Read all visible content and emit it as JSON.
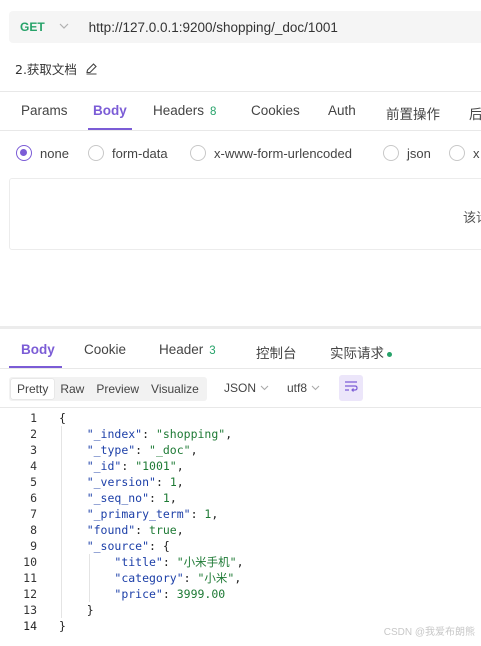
{
  "request": {
    "method": "GET",
    "url": "http://127.0.0.1:9200/shopping/_doc/1001",
    "name": "2.获取文档"
  },
  "request_tabs": [
    {
      "label": "Params"
    },
    {
      "label": "Body",
      "active": true
    },
    {
      "label": "Headers",
      "count": "8"
    },
    {
      "label": "Cookies"
    },
    {
      "label": "Auth"
    },
    {
      "label": "前置操作"
    },
    {
      "label": "后"
    }
  ],
  "body_types": [
    {
      "label": "none",
      "selected": true
    },
    {
      "label": "form-data"
    },
    {
      "label": "x-www-form-urlencoded"
    },
    {
      "label": "json"
    },
    {
      "label": "x"
    }
  ],
  "editor_hint": "该请",
  "response_tabs": [
    {
      "label": "Body",
      "active": true
    },
    {
      "label": "Cookie"
    },
    {
      "label": "Header",
      "count": "3"
    },
    {
      "label": "控制台"
    },
    {
      "label": "实际请求"
    }
  ],
  "format_buttons": [
    {
      "label": "Pretty",
      "active": true
    },
    {
      "label": "Raw"
    },
    {
      "label": "Preview"
    },
    {
      "label": "Visualize"
    }
  ],
  "selects": {
    "type": "JSON",
    "encoding": "utf8"
  },
  "code_lines": [
    "{",
    "    \"_index\": \"shopping\",",
    "    \"_type\": \"_doc\",",
    "    \"_id\": \"1001\",",
    "    \"_version\": 1,",
    "    \"_seq_no\": 1,",
    "    \"_primary_term\": 1,",
    "    \"found\": true,",
    "    \"_source\": {",
    "        \"title\": \"小米手机\",",
    "        \"category\": \"小米\",",
    "        \"price\": 3999.00",
    "    }",
    "}"
  ],
  "watermark": "CSDN @我爱布朗熊",
  "colors": {
    "accent": "#7b5cd6",
    "method_get": "#26a269",
    "json_key": "#1c3fa8",
    "json_value": "#1e7a35"
  }
}
